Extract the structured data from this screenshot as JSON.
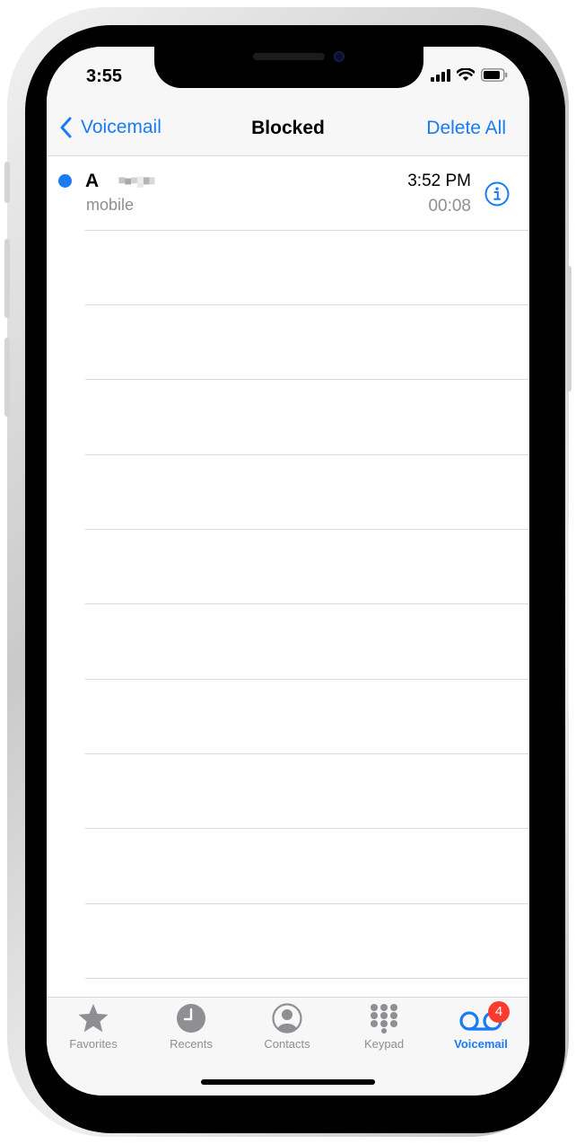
{
  "status_bar": {
    "time": "3:55"
  },
  "nav": {
    "back_label": "Voicemail",
    "title": "Blocked",
    "right_action": "Delete All"
  },
  "voicemails": [
    {
      "caller": "A",
      "label": "mobile",
      "time": "3:52 PM",
      "duration": "00:08",
      "unread": true
    }
  ],
  "tabs": [
    {
      "label": "Favorites",
      "icon": "star-icon"
    },
    {
      "label": "Recents",
      "icon": "clock-icon"
    },
    {
      "label": "Contacts",
      "icon": "person-circle-icon"
    },
    {
      "label": "Keypad",
      "icon": "keypad-icon"
    },
    {
      "label": "Voicemail",
      "icon": "voicemail-icon",
      "active": true,
      "badge": "4"
    }
  ],
  "colors": {
    "accent": "#1a7cf4",
    "badge": "#ff3b30",
    "secondary_text": "#8e8e93"
  }
}
